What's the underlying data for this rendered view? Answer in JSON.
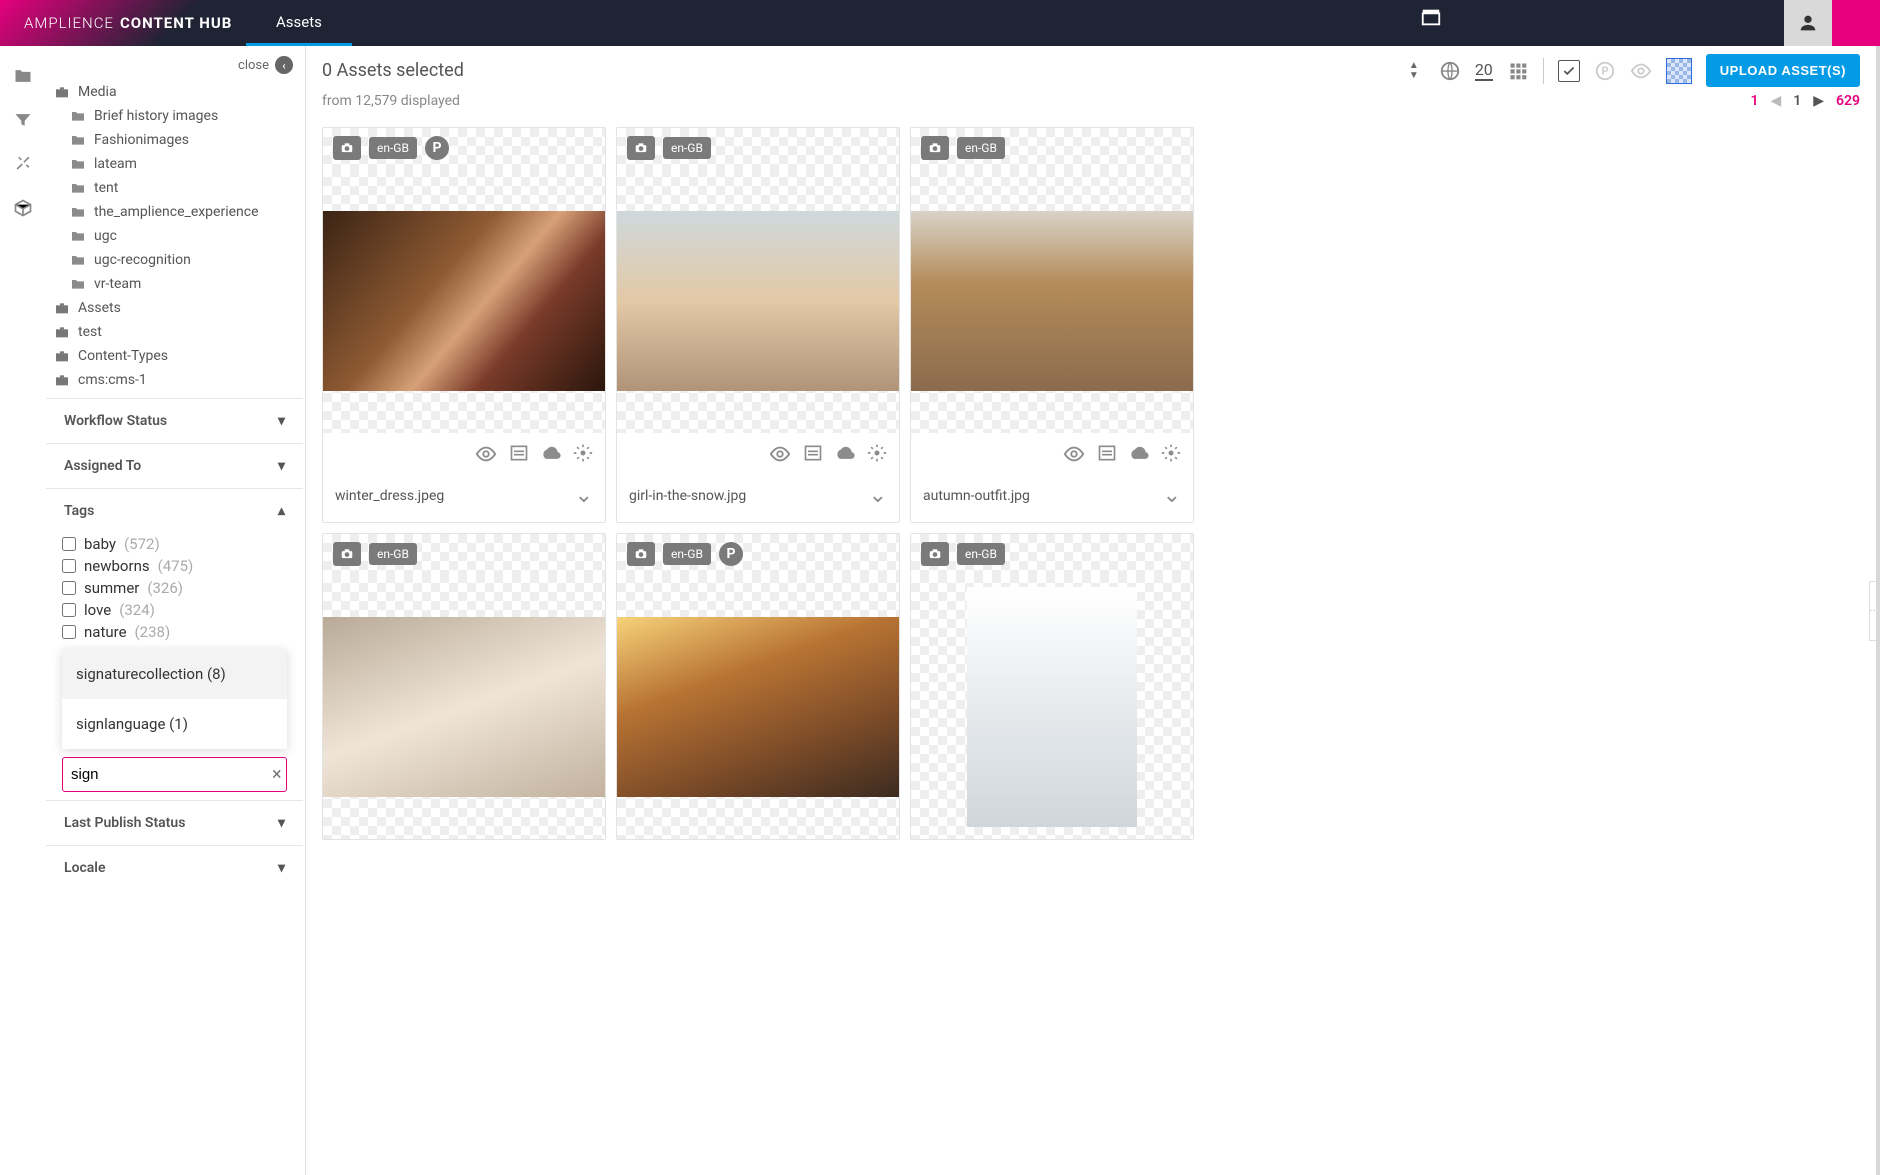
{
  "brand": {
    "light": "AMPLIENCE",
    "bold": "CONTENT HUB"
  },
  "nav": {
    "assets": "Assets"
  },
  "sidebar": {
    "close": "close",
    "treeRoot": "Media",
    "folders": [
      "Brief history images",
      "Fashionimages",
      "lateam",
      "tent",
      "the_amplience_experience",
      "ugc",
      "ugc-recognition",
      "vr-team"
    ],
    "libs": [
      "Assets",
      "test",
      "Content-Types",
      "cms:cms-1"
    ],
    "accordion": {
      "workflow": "Workflow Status",
      "assigned": "Assigned To",
      "tags": "Tags",
      "lastPublish": "Last Publish Status",
      "locale": "Locale"
    },
    "tags": [
      {
        "name": "baby",
        "count": "(572)"
      },
      {
        "name": "newborns",
        "count": "(475)"
      },
      {
        "name": "summer",
        "count": "(326)"
      },
      {
        "name": "love",
        "count": "(324)"
      },
      {
        "name": "nature",
        "count": "(238)"
      }
    ],
    "suggest": [
      "signaturecollection (8)",
      "signlanguage (1)"
    ],
    "searchValue": "sign"
  },
  "toolbar": {
    "selected": "0 Assets selected",
    "displayed": "from 12,579 displayed",
    "perPage": "20",
    "upload": "UPLOAD ASSET(S)"
  },
  "pager": {
    "first": "1",
    "cur": "1",
    "last": "629"
  },
  "assets": [
    {
      "locale": "en-GB",
      "p": true,
      "thumbCls": "th1",
      "name": "winter_dress.jpeg"
    },
    {
      "locale": "en-GB",
      "p": false,
      "thumbCls": "th2",
      "name": "girl-in-the-snow.jpg"
    },
    {
      "locale": "en-GB",
      "p": false,
      "thumbCls": "th3",
      "name": "autumn-outfit.jpg"
    },
    {
      "locale": "en-GB",
      "p": false,
      "thumbCls": "th4",
      "name": ""
    },
    {
      "locale": "en-GB",
      "p": true,
      "thumbCls": "th5",
      "name": ""
    },
    {
      "locale": "en-GB",
      "p": false,
      "thumbCls": "th6",
      "name": ""
    }
  ]
}
